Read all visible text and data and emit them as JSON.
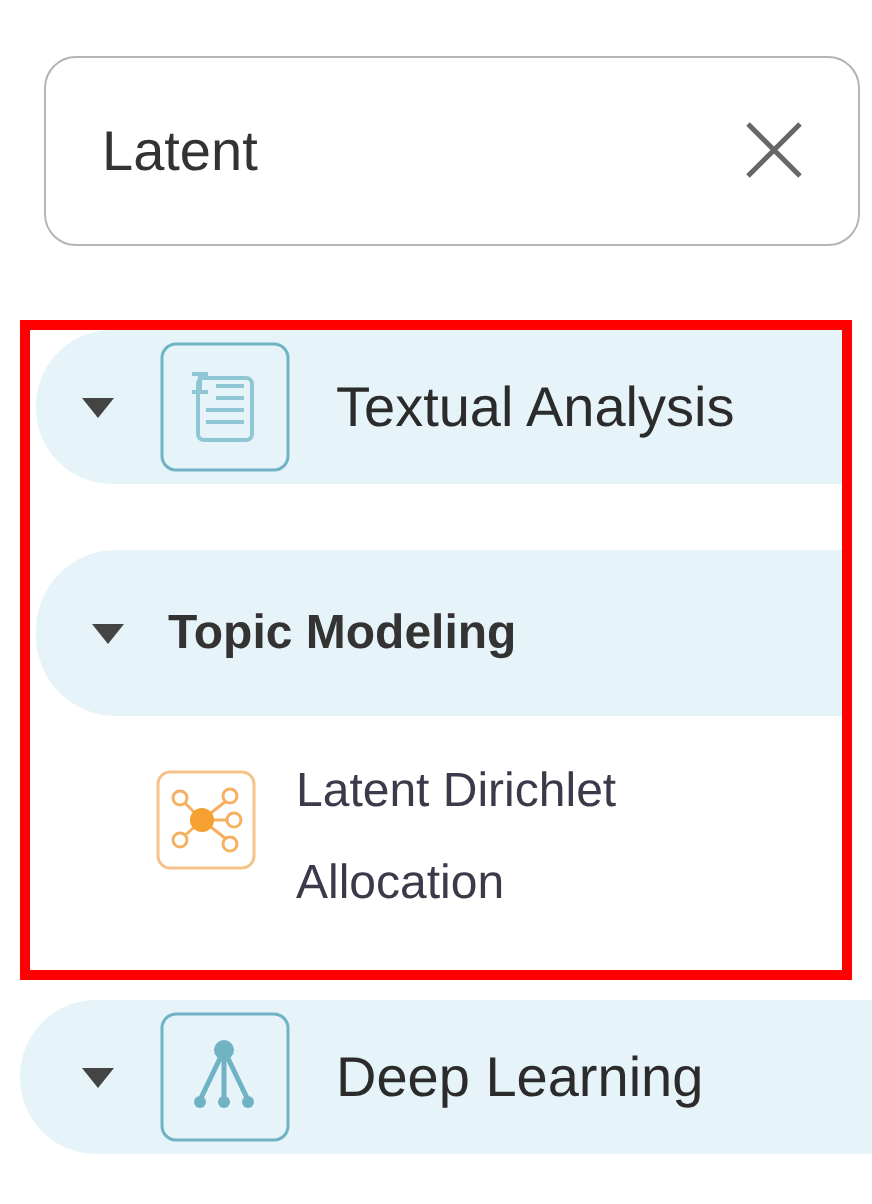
{
  "search": {
    "value": "Latent"
  },
  "tree": [
    {
      "kind": "category",
      "label": "Textual Analysis",
      "expanded": true,
      "highlighted": true,
      "children": [
        {
          "kind": "group",
          "label": "Topic Modeling",
          "expanded": true,
          "children": [
            {
              "kind": "algorithm",
              "label": "Latent Dirichlet Allocation"
            }
          ]
        }
      ]
    },
    {
      "kind": "category",
      "label": "Deep Learning",
      "expanded": true,
      "highlighted": false
    }
  ]
}
